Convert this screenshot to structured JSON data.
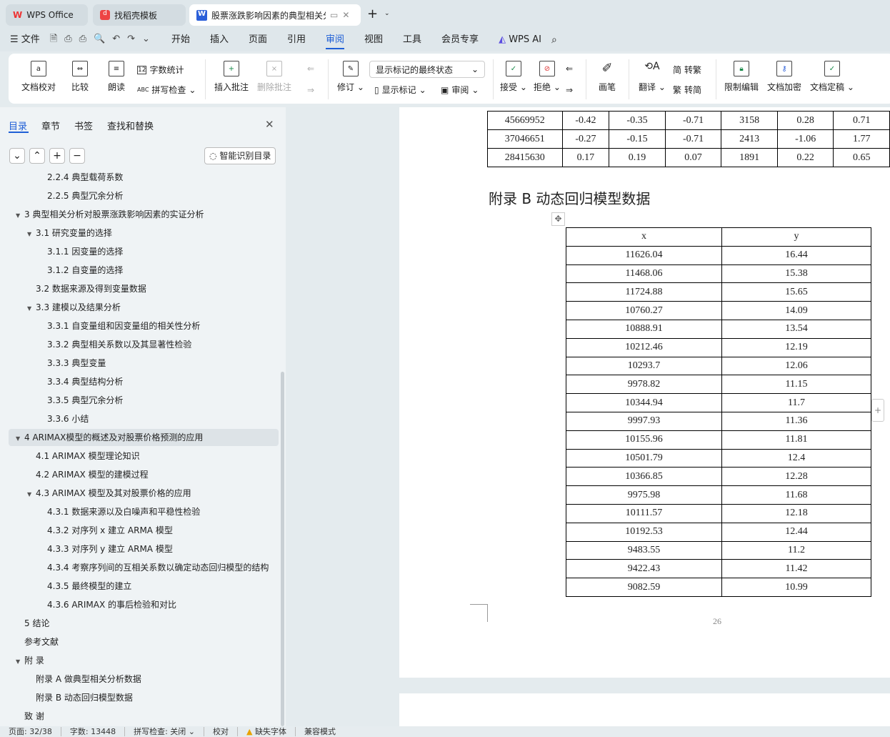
{
  "tabs": [
    {
      "label": "WPS Office",
      "icon": "wps-logo-icon"
    },
    {
      "label": "找稻壳模板",
      "icon": "docer-icon"
    },
    {
      "label": "股票涨跌影响因素的典型相关分",
      "icon": "writer-doc-icon"
    }
  ],
  "menu": {
    "file": "文件",
    "items": [
      "开始",
      "插入",
      "页面",
      "引用",
      "审阅",
      "视图",
      "工具",
      "会员专享"
    ],
    "active": "审阅",
    "ai": "WPS AI"
  },
  "ribbon": {
    "proof": "文档校对",
    "compare": "比较",
    "read": "朗读",
    "wordcount": "字数统计",
    "spell": "拼写检查",
    "insert_comment": "插入批注",
    "delete_comment": "删除批注",
    "revise": "修订",
    "display_mode": "显示标记的最终状态",
    "show_marks": "显示标记",
    "review": "审阅",
    "accept": "接受",
    "reject": "拒绝",
    "pen": "画笔",
    "translate": "翻译",
    "to_trad": "转繁",
    "to_simp": "转简",
    "restrict": "限制编辑",
    "encrypt": "文档加密",
    "finalize": "文档定稿"
  },
  "sidebar": {
    "tabs": [
      "目录",
      "章节",
      "书签",
      "查找和替换"
    ],
    "smart_btn": "智能识别目录",
    "items": [
      {
        "text": "2.2.4  典型载荷系数",
        "level": 3,
        "arrow": ""
      },
      {
        "text": "2.2.5  典型冗余分析",
        "level": 3,
        "arrow": ""
      },
      {
        "text": "3  典型相关分析对股票涨跌影响因素的实证分析",
        "level": 1,
        "arrow": "▼"
      },
      {
        "text": "3.1  研究变量的选择",
        "level": 2,
        "arrow": "▼"
      },
      {
        "text": "3.1.1  因变量的选择",
        "level": 3,
        "arrow": ""
      },
      {
        "text": "3.1.2  自变量的选择",
        "level": 3,
        "arrow": ""
      },
      {
        "text": "3.2  数据来源及得到变量数据",
        "level": 2,
        "arrow": ""
      },
      {
        "text": "3.3  建模以及结果分析",
        "level": 2,
        "arrow": "▼"
      },
      {
        "text": "3.3.1  自变量组和因变量组的相关性分析",
        "level": 3,
        "arrow": ""
      },
      {
        "text": "3.3.2  典型相关系数以及其显著性检验",
        "level": 3,
        "arrow": ""
      },
      {
        "text": "3.3.3  典型变量",
        "level": 3,
        "arrow": ""
      },
      {
        "text": "3.3.4  典型结构分析",
        "level": 3,
        "arrow": ""
      },
      {
        "text": "3.3.5  典型冗余分析",
        "level": 3,
        "arrow": ""
      },
      {
        "text": "3.3.6  小结",
        "level": 3,
        "arrow": ""
      },
      {
        "text": "4 ARIMAX模型的概述及对股票价格预测的应用",
        "level": 1,
        "arrow": "▼",
        "selected": true
      },
      {
        "text": "4.1 ARIMAX 模型理论知识",
        "level": 2,
        "arrow": ""
      },
      {
        "text": "4.2 ARIMAX 模型的建模过程",
        "level": 2,
        "arrow": ""
      },
      {
        "text": "4.3 ARIMAX 模型及其对股票价格的应用",
        "level": 2,
        "arrow": "▼"
      },
      {
        "text": "4.3.1  数据来源以及白噪声和平稳性检验",
        "level": 3,
        "arrow": ""
      },
      {
        "text": "4.3.2  对序列 x 建立 ARMA 模型",
        "level": 3,
        "arrow": ""
      },
      {
        "text": "4.3.3  对序列 y 建立 ARMA 模型",
        "level": 3,
        "arrow": ""
      },
      {
        "text": "4.3.4  考察序列间的互相关系数以确定动态回归模型的结构",
        "level": 3,
        "arrow": ""
      },
      {
        "text": "4.3.5  最终模型的建立",
        "level": 3,
        "arrow": ""
      },
      {
        "text": "4.3.6 ARIMAX 的事后检验和对比",
        "level": 3,
        "arrow": ""
      },
      {
        "text": "5  结论",
        "level": 1,
        "arrow": ""
      },
      {
        "text": "参考文献",
        "level": 1,
        "arrow": ""
      },
      {
        "text": "附  录",
        "level": 1,
        "arrow": "▼"
      },
      {
        "text": "附录 A  做典型相关分析数据",
        "level": 2,
        "arrow": ""
      },
      {
        "text": "附录 B  动态回归模型数据",
        "level": 2,
        "arrow": ""
      },
      {
        "text": "致  谢",
        "level": 1,
        "arrow": ""
      }
    ]
  },
  "doc": {
    "top_table": [
      [
        "45669952",
        "-0.42",
        "-0.35",
        "-0.71",
        "3158",
        "0.28",
        "0.71"
      ],
      [
        "37046651",
        "-0.27",
        "-0.15",
        "-0.71",
        "2413",
        "-1.06",
        "1.77"
      ],
      [
        "28415630",
        "0.17",
        "0.19",
        "0.07",
        "1891",
        "0.22",
        "0.65"
      ]
    ],
    "appendix_title": "附录 B  动态回归模型数据",
    "table_b_header": [
      "x",
      "y"
    ],
    "table_b": [
      [
        "11626.04",
        "16.44"
      ],
      [
        "11468.06",
        "15.38"
      ],
      [
        "11724.88",
        "15.65"
      ],
      [
        "10760.27",
        "14.09"
      ],
      [
        "10888.91",
        "13.54"
      ],
      [
        "10212.46",
        "12.19"
      ],
      [
        "10293.7",
        "12.06"
      ],
      [
        "9978.82",
        "11.15"
      ],
      [
        "10344.94",
        "11.7"
      ],
      [
        "9997.93",
        "11.36"
      ],
      [
        "10155.96",
        "11.81"
      ],
      [
        "10501.79",
        "12.4"
      ],
      [
        "10366.85",
        "12.28"
      ],
      [
        "9975.98",
        "11.68"
      ],
      [
        "10111.57",
        "12.18"
      ],
      [
        "10192.53",
        "12.44"
      ],
      [
        "9483.55",
        "11.2"
      ],
      [
        "9422.43",
        "11.42"
      ],
      [
        "9082.59",
        "10.99"
      ]
    ],
    "page_number": "26"
  },
  "status": {
    "page": "页面: 32/38",
    "words": "字数: 13448",
    "spell": "拼写检查: 关闭",
    "proof": "校对",
    "missing_font": "缺失字体",
    "compat": "兼容模式"
  }
}
